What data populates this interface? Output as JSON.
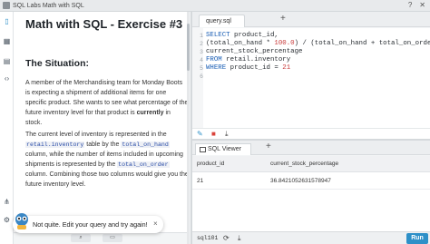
{
  "window": {
    "title": "SQL Labs Math with SQL"
  },
  "lesson": {
    "title": "Math with SQL - Exercise #3",
    "section": "The Situation:",
    "para1_a": "A member of the Merchandising team for Monday Boots is expecting a shipment of additional items for one specific product. She wants to see what percentage of the future inventory level for that product is ",
    "para1_kw": "currently",
    "para1_b": " in stock.",
    "para2_a": "The current level of inventory is represented in the ",
    "para2_code1": "retail.inventory",
    "para2_b": " table by the ",
    "para2_code2": "total_on_hand",
    "para2_c": " column, while the number of items included in upcoming shipments is represented by the ",
    "para2_code3": "total_on_order",
    "para2_d": " column. Combining those two columns would give you the future inventory level."
  },
  "toast": {
    "message": "Not quite. Edit your query and try again!",
    "close": "×"
  },
  "editor": {
    "tab_label": "query.sql",
    "lines": [
      {
        "n": "1",
        "kw": "SELECT",
        "text": " product_id,"
      },
      {
        "n": "2",
        "pre": "(total_on_hand * ",
        "num": "100.0",
        "post": ") / (total_on_hand + total_on_order)"
      },
      {
        "n": "3",
        "text": "current_stock_percentage"
      },
      {
        "n": "4",
        "kw": "FROM",
        "text": " retail.inventory"
      },
      {
        "n": "5",
        "kw": "WHERE",
        "text": " product_id = ",
        "num": "21"
      },
      {
        "n": "6",
        "text": ""
      }
    ]
  },
  "results": {
    "tab_label": "SQL Viewer",
    "columns": [
      "product_id",
      "current_stock_percentage"
    ],
    "rows": [
      [
        "21",
        "36.8421052631578947"
      ]
    ]
  },
  "bottom": {
    "connection": "sql101",
    "run_label": "Run"
  },
  "colors": {
    "accent": "#2e90c8",
    "keyword": "#1b5fb5",
    "number": "#c83a3a"
  }
}
